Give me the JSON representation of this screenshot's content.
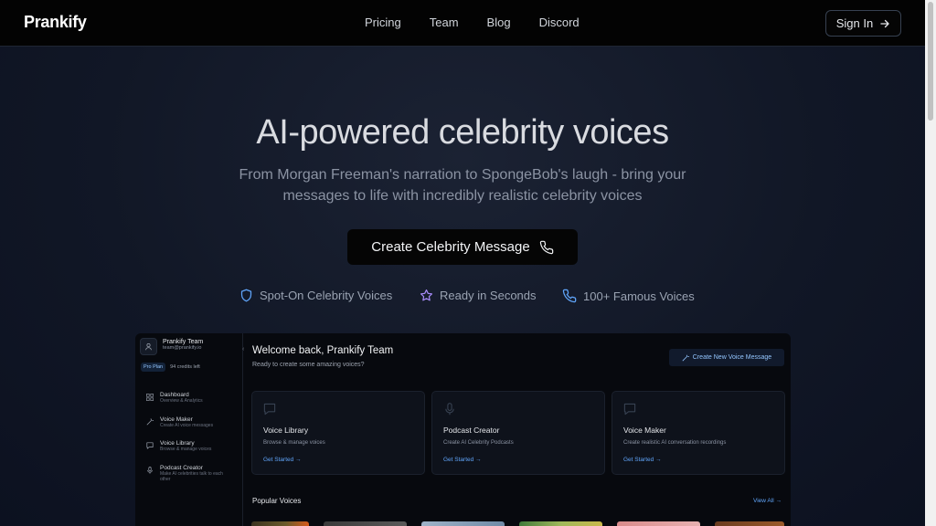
{
  "nav": {
    "logo": "Prankify",
    "links": [
      "Pricing",
      "Team",
      "Blog",
      "Discord"
    ],
    "signin": "Sign In"
  },
  "hero": {
    "title": "AI-powered celebrity voices",
    "subtitle": "From Morgan Freeman's narration to SpongeBob's laugh - bring your messages to life with incredibly realistic celebrity voices",
    "cta": "Create Celebrity Message",
    "features": [
      {
        "label": "Spot-On Celebrity Voices",
        "icon": "shield-icon",
        "color": "#60a5fa"
      },
      {
        "label": "Ready in Seconds",
        "icon": "star-icon",
        "color": "#a78bfa"
      },
      {
        "label": "100+ Famous Voices",
        "icon": "phone-icon",
        "color": "#60a5fa"
      }
    ]
  },
  "dashboard": {
    "user_name": "Prankify Team",
    "user_email": "team@prankify.io",
    "plan": "Pro Plan",
    "credits": "94 credits left",
    "sidebar": [
      {
        "title": "Dashboard",
        "sub": "Overview & Analytics",
        "icon": "grid-icon"
      },
      {
        "title": "Voice Maker",
        "sub": "Create AI voice messages",
        "icon": "wand-icon"
      },
      {
        "title": "Voice Library",
        "sub": "Browse & manage voices",
        "icon": "message-icon"
      },
      {
        "title": "Podcast Creator",
        "sub": "Make AI celebrities talk to each other",
        "icon": "mic-icon"
      }
    ],
    "welcome": "Welcome back, Prankify Team",
    "welcome_sub": "Ready to create some amazing voices?",
    "new_button": "Create New Voice Message",
    "cards": [
      {
        "title": "Voice Library",
        "sub": "Browse & manage voices",
        "link": "Get Started →",
        "icon": "message-icon"
      },
      {
        "title": "Podcast Creator",
        "sub": "Create AI Celebrity Podcasts",
        "link": "Get Started →",
        "icon": "mic-icon"
      },
      {
        "title": "Voice Maker",
        "sub": "Create realistic AI conversation recordings",
        "link": "Get Started →",
        "icon": "message-icon"
      }
    ],
    "popular_title": "Popular Voices",
    "view_all": "View All →"
  }
}
